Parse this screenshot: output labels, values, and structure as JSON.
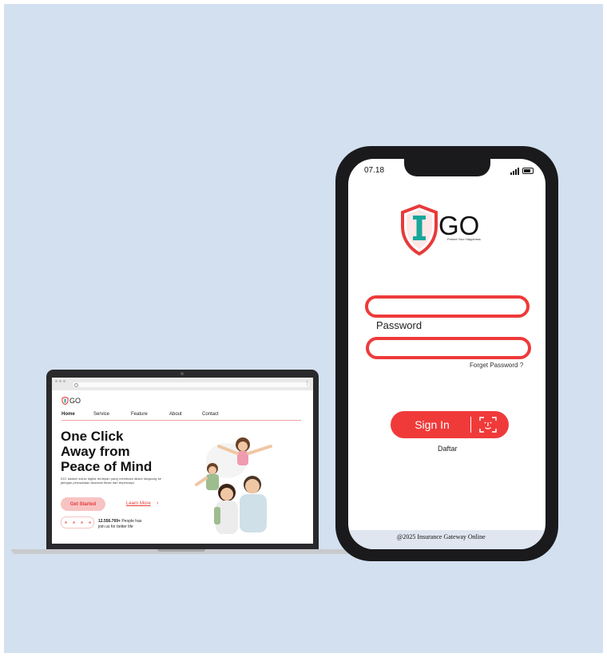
{
  "colors": {
    "background": "#d3e0ef",
    "accent": "#f03a3a",
    "text": "#111111"
  },
  "laptop": {
    "logo_text": "GO",
    "nav": [
      "Home",
      "Service",
      "Feature",
      "About",
      "Contact"
    ],
    "title_lines": [
      "One Click",
      "Away from",
      "Peace of Mind"
    ],
    "description": "IGO adalah solusi digital terdepan yang membuka akses langsung ke jaringan perusahaan asuransi besar dan terpercaya.",
    "get_started": "Get Started",
    "learn_more": "Learn More",
    "learn_more_arrow": "›",
    "people_count": "12.556.769+",
    "people_text_1": " People has",
    "people_text_2": "join us for better life",
    "icons": {
      "menu": "kebab-menu-icon",
      "search": "search-icon"
    }
  },
  "phone": {
    "status_time": "07.18",
    "logo_text": "GO",
    "tagline": "Protect Your Happiness",
    "password_label": "Password",
    "forgot_password": "Forget Password ?",
    "sign_in": "Sign In",
    "register": "Daftar",
    "footer": "@2025 Insurance Gateway Online",
    "icons": {
      "signal": "signal-icon",
      "battery": "battery-icon",
      "face_id": "face-id-icon",
      "shield": "shield-logo-icon"
    }
  }
}
